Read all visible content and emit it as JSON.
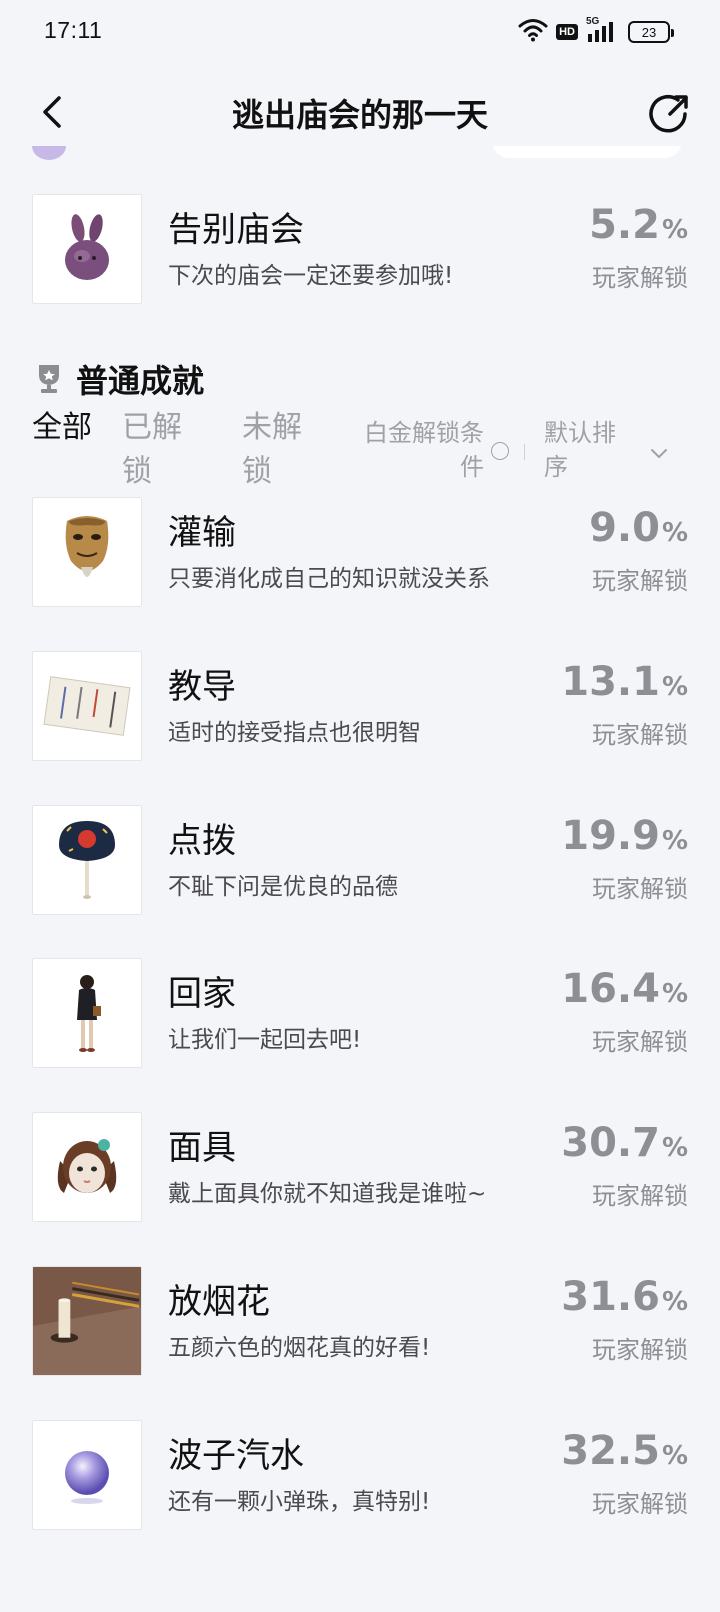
{
  "status_bar": {
    "time": "17:11",
    "hd": "HD",
    "network": "5G",
    "battery": "23"
  },
  "header": {
    "title": "逃出庙会的那一天"
  },
  "featured_achievement": {
    "name": "告别庙会",
    "desc": "下次的庙会一定还要参加哦!",
    "pct": "5.2",
    "unit": "%",
    "unlock_label": "玩家解锁",
    "icon": "purple-rabbit-icon"
  },
  "section": {
    "title": "普通成就",
    "icon": "trophy-icon"
  },
  "filters": {
    "tabs": [
      "全部",
      "已解锁",
      "未解锁"
    ],
    "active_index": 0,
    "platinum_label": "白金解锁条件",
    "sort_label": "默认排序"
  },
  "achievements": [
    {
      "name": "灌输",
      "desc": "只要消化成自己的知识就没关系",
      "pct": "9.0",
      "unit": "%",
      "unlock_label": "玩家解锁",
      "icon": "old-mask-icon"
    },
    {
      "name": "教导",
      "desc": "适时的接受指点也很明智",
      "pct": "13.1",
      "unit": "%",
      "unlock_label": "玩家解锁",
      "icon": "paper-note-icon"
    },
    {
      "name": "点拨",
      "desc": "不耻下问是优良的品德",
      "pct": "19.9",
      "unit": "%",
      "unlock_label": "玩家解锁",
      "icon": "uchiwa-fan-icon"
    },
    {
      "name": "回家",
      "desc": "让我们一起回去吧!",
      "pct": "16.4",
      "unit": "%",
      "unlock_label": "玩家解锁",
      "icon": "walking-girl-icon"
    },
    {
      "name": "面具",
      "desc": "戴上面具你就不知道我是谁啦~",
      "pct": "30.7",
      "unit": "%",
      "unlock_label": "玩家解锁",
      "icon": "girl-mask-icon"
    },
    {
      "name": "放烟花",
      "desc": "五颜六色的烟花真的好看!",
      "pct": "31.6",
      "unit": "%",
      "unlock_label": "玩家解锁",
      "icon": "sparkler-candle-icon"
    },
    {
      "name": "波子汽水",
      "desc": "还有一颗小弹珠，真特别!",
      "pct": "32.5",
      "unit": "%",
      "unlock_label": "玩家解锁",
      "icon": "marble-icon"
    }
  ]
}
